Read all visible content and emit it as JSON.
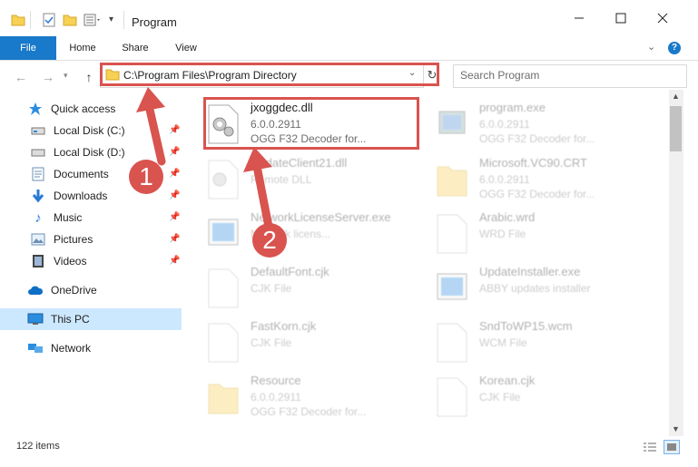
{
  "window": {
    "title": "Program",
    "minimize_icon": "minimize-icon",
    "maximize_icon": "maximize-icon",
    "close_icon": "close-icon"
  },
  "ribbon": {
    "tabs": [
      {
        "label": "File",
        "active": true
      },
      {
        "label": "Home"
      },
      {
        "label": "Share"
      },
      {
        "label": "View"
      }
    ],
    "accent": "#1979ca"
  },
  "address": {
    "path": "C:\\Program Files\\Program Directory"
  },
  "search": {
    "placeholder": "Search Program"
  },
  "sidebar": {
    "quick_access": "Quick access",
    "items": [
      {
        "label": "Local Disk (C:)",
        "icon": "drive-icon"
      },
      {
        "label": "Local Disk (D:)",
        "icon": "drive-icon"
      },
      {
        "label": "Documents",
        "icon": "documents-icon"
      },
      {
        "label": "Downloads",
        "icon": "downloads-icon"
      },
      {
        "label": "Music",
        "icon": "music-icon"
      },
      {
        "label": "Pictures",
        "icon": "pictures-icon"
      },
      {
        "label": "Videos",
        "icon": "videos-icon"
      }
    ],
    "onedrive": "OneDrive",
    "this_pc": "This PC",
    "network": "Network"
  },
  "files": [
    {
      "name": "jxoggdec.dll",
      "line2": "6.0.0.2911",
      "line3": "OGG F32 Decoder for..."
    },
    {
      "name": "program.exe",
      "line2": "6.0.0.2911",
      "line3": "OGG F32 Decoder for..."
    },
    {
      "name": "UpdateClient21.dll",
      "line2": "Remote DLL",
      "line3": ""
    },
    {
      "name": "Microsoft.VC90.CRT",
      "line2": "6.0.0.2911",
      "line3": "OGG F32 Decoder for..."
    },
    {
      "name": "NetworkLicenseServer.exe",
      "line2": "Network licens...",
      "line3": ""
    },
    {
      "name": "Arabic.wrd",
      "line2": "WRD File",
      "line3": ""
    },
    {
      "name": "DefaultFont.cjk",
      "line2": "CJK File",
      "line3": ""
    },
    {
      "name": "UpdateInstaller.exe",
      "line2": "ABBY updates installer",
      "line3": ""
    },
    {
      "name": "FastKorn.cjk",
      "line2": "CJK File",
      "line3": ""
    },
    {
      "name": "SndToWP15.wcm",
      "line2": "WCM File",
      "line3": ""
    },
    {
      "name": "Resource",
      "line2": "6.0.0.2911",
      "line3": "OGG F32 Decoder for..."
    },
    {
      "name": "Korean.cjk",
      "line2": "CJK File",
      "line3": ""
    }
  ],
  "status": {
    "count": "122 items"
  },
  "callouts": {
    "one": "1",
    "two": "2",
    "color": "#d9534f"
  }
}
